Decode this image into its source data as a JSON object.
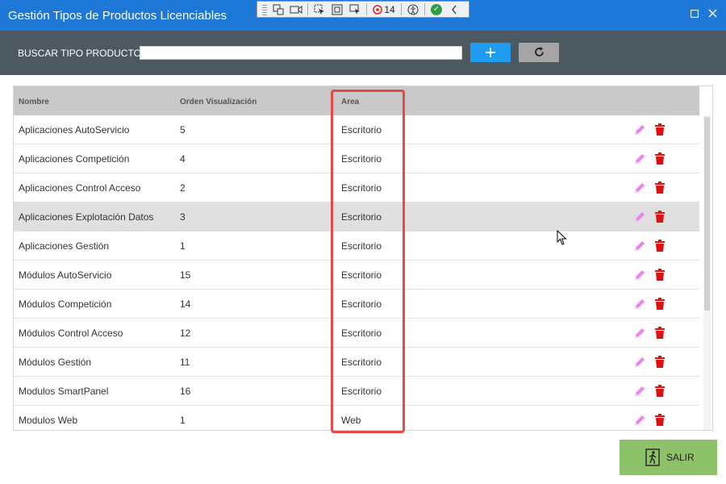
{
  "window": {
    "title": "Gestión Tipos de Productos Licenciables"
  },
  "devtoolbar": {
    "count": "14"
  },
  "search": {
    "label": "BUSCAR TIPO PRODUCTO",
    "value": "",
    "placeholder": ""
  },
  "table": {
    "headers": [
      "Nombre",
      "Orden Visualización",
      "Area"
    ],
    "rows": [
      {
        "name": "Aplicaciones AutoServicio",
        "order": "5",
        "area": "Escritorio"
      },
      {
        "name": "Aplicaciones Competición",
        "order": "4",
        "area": "Escritorio"
      },
      {
        "name": "Aplicaciones Control Acceso",
        "order": "2",
        "area": "Escritorio"
      },
      {
        "name": "Aplicaciones Explotación Datos",
        "order": "3",
        "area": "Escritorio"
      },
      {
        "name": "Aplicaciones Gestión",
        "order": "1",
        "area": "Escritorio"
      },
      {
        "name": "Módulos AutoServicio",
        "order": "15",
        "area": "Escritorio"
      },
      {
        "name": "Módulos Competición",
        "order": "14",
        "area": "Escritorio"
      },
      {
        "name": "Módulos Control Acceso",
        "order": "12",
        "area": "Escritorio"
      },
      {
        "name": "Módulos Gestión",
        "order": "11",
        "area": "Escritorio"
      },
      {
        "name": "Modulos SmartPanel",
        "order": "16",
        "area": "Escritorio"
      },
      {
        "name": "Modulos Web",
        "order": "1",
        "area": "Web"
      }
    ]
  },
  "footer": {
    "exit_label": "SALIR"
  },
  "colors": {
    "titlebar": "#1e78d7",
    "searchbar": "#4d5960",
    "add": "#1f9cf0",
    "exit": "#8dc26a",
    "edit": "#ee82ee",
    "delete": "#e01010",
    "highlight": "#e34b4b"
  }
}
